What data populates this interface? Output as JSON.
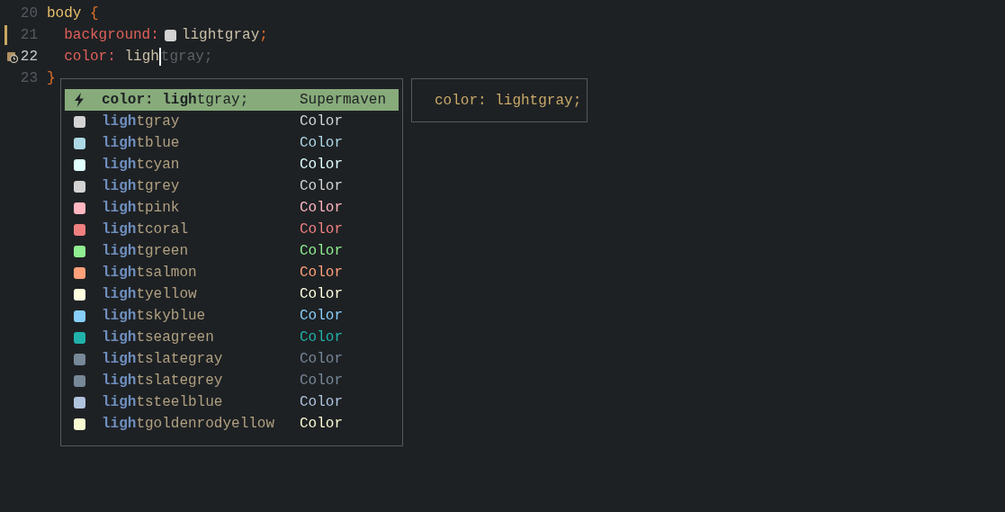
{
  "editor": {
    "lines": [
      {
        "number": "20",
        "current": false,
        "modified": false,
        "tokens": [
          {
            "kind": "selector",
            "text": "body"
          },
          {
            "kind": "brace",
            "text": " {"
          }
        ]
      },
      {
        "number": "21",
        "current": false,
        "modified": true,
        "tokens": [
          {
            "kind": "property",
            "text": "  background:"
          },
          {
            "kind": "swatch",
            "color": "#d3d3d3"
          },
          {
            "kind": "value",
            "text": "lightgray"
          },
          {
            "kind": "punct",
            "text": ";"
          }
        ]
      },
      {
        "number": "22",
        "current": true,
        "modified": false,
        "tokens": [
          {
            "kind": "property",
            "text": "  color: "
          },
          {
            "kind": "value",
            "text": "ligh"
          },
          {
            "kind": "cursor"
          },
          {
            "kind": "ghost",
            "text": "tgray;"
          }
        ]
      },
      {
        "number": "23",
        "current": false,
        "modified": false,
        "tokens": [
          {
            "kind": "brace",
            "text": "}"
          }
        ]
      }
    ]
  },
  "completion": {
    "items": [
      {
        "kind": "ai",
        "selected": true,
        "match": "color: ligh",
        "rest": "tgray;",
        "type": "Supermaven"
      },
      {
        "kind": "color",
        "selected": false,
        "match": "ligh",
        "rest": "tgray",
        "type": "Color",
        "color": "#d3d3d3"
      },
      {
        "kind": "color",
        "selected": false,
        "match": "ligh",
        "rest": "tblue",
        "type": "Color",
        "color": "#add8e6"
      },
      {
        "kind": "color",
        "selected": false,
        "match": "ligh",
        "rest": "tcyan",
        "type": "Color",
        "color": "#e0ffff"
      },
      {
        "kind": "color",
        "selected": false,
        "match": "ligh",
        "rest": "tgrey",
        "type": "Color",
        "color": "#d3d3d3"
      },
      {
        "kind": "color",
        "selected": false,
        "match": "ligh",
        "rest": "tpink",
        "type": "Color",
        "color": "#ffb6c1"
      },
      {
        "kind": "color",
        "selected": false,
        "match": "ligh",
        "rest": "tcoral",
        "type": "Color",
        "color": "#f08080"
      },
      {
        "kind": "color",
        "selected": false,
        "match": "ligh",
        "rest": "tgreen",
        "type": "Color",
        "color": "#90ee90"
      },
      {
        "kind": "color",
        "selected": false,
        "match": "ligh",
        "rest": "tsalmon",
        "type": "Color",
        "color": "#ffa07a"
      },
      {
        "kind": "color",
        "selected": false,
        "match": "ligh",
        "rest": "tyellow",
        "type": "Color",
        "color": "#ffffe0"
      },
      {
        "kind": "color",
        "selected": false,
        "match": "ligh",
        "rest": "tskyblue",
        "type": "Color",
        "color": "#87cefa"
      },
      {
        "kind": "color",
        "selected": false,
        "match": "ligh",
        "rest": "tseagreen",
        "type": "Color",
        "color": "#20b2aa"
      },
      {
        "kind": "color",
        "selected": false,
        "match": "ligh",
        "rest": "tslategray",
        "type": "Color",
        "color": "#778899"
      },
      {
        "kind": "color",
        "selected": false,
        "match": "ligh",
        "rest": "tslategrey",
        "type": "Color",
        "color": "#778899"
      },
      {
        "kind": "color",
        "selected": false,
        "match": "ligh",
        "rest": "tsteelblue",
        "type": "Color",
        "color": "#b0c4de"
      },
      {
        "kind": "color",
        "selected": false,
        "match": "ligh",
        "rest": "tgoldenrodyellow",
        "type": "Color",
        "color": "#fafad2"
      }
    ]
  },
  "preview": {
    "text": "color: lightgray;"
  }
}
